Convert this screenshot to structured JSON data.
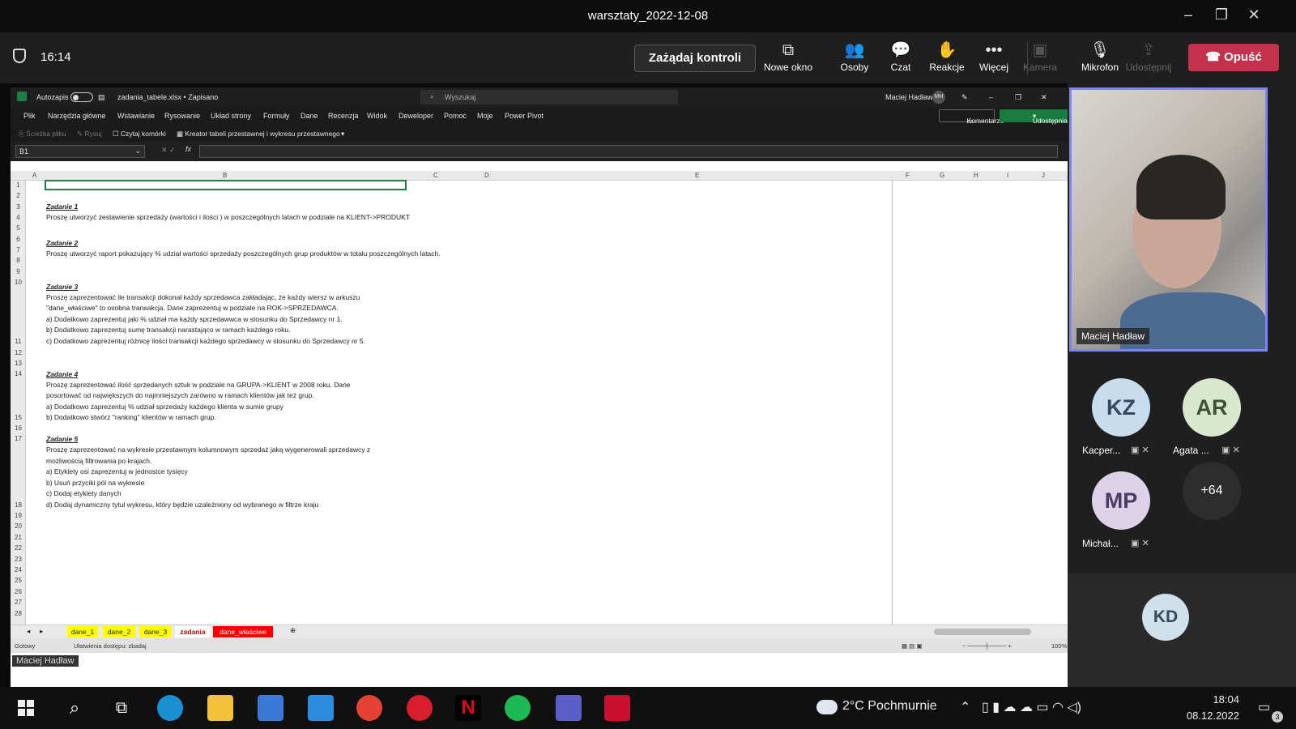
{
  "window": {
    "title": "warsztaty_2022-12-08"
  },
  "teams": {
    "timer": "16:14",
    "request_control": "Zażądaj kontroli",
    "toolbar": [
      {
        "label": "Nowe okno",
        "icon": "new-window-icon",
        "glyph": "⧉",
        "enabled": true
      },
      {
        "label": "Osoby",
        "icon": "people-icon",
        "glyph": "👥",
        "enabled": true
      },
      {
        "label": "Czat",
        "icon": "chat-icon",
        "glyph": "💬",
        "enabled": true
      },
      {
        "label": "Reakcje",
        "icon": "reactions-icon",
        "glyph": "✋",
        "enabled": true
      },
      {
        "label": "Więcej",
        "icon": "more-icon",
        "glyph": "•••",
        "enabled": true
      },
      {
        "label": "Kamera",
        "icon": "camera-off-icon",
        "glyph": "▣",
        "enabled": false
      },
      {
        "label": "Mikrofon",
        "icon": "mic-off-icon",
        "glyph": "🎙",
        "enabled": true
      },
      {
        "label": "Udostępnij",
        "icon": "share-icon",
        "glyph": "⇪",
        "enabled": false
      }
    ],
    "leave": "Opuść",
    "leave_color": "#c4314b"
  },
  "excel": {
    "autosave": "Autozapis",
    "filename": "zadania_tabele.xlsx • Zapisano",
    "search_placeholder": "Wyszukaj",
    "user": "Maciej Hadław",
    "user_initials": "MH",
    "menu": [
      "Plik",
      "Narzędzia główne",
      "Wstawianie",
      "Rysowanie",
      "Układ strony",
      "Formuły",
      "Dane",
      "Recenzja",
      "Widok",
      "Deweloper",
      "Pomoc",
      "Moje",
      "Power Pivot"
    ],
    "comments_btn": "Komentarze",
    "share_btn": "Udostępnianie",
    "quick": [
      "Ścieżka pliku",
      "Rysuj",
      "Czytaj komórki",
      "Kreator tabeli przestawnej i wykresu przestawnego"
    ],
    "namebox": "B1",
    "fx": "fx",
    "columns": [
      "A",
      "B",
      "C",
      "D",
      "E",
      "F",
      "G",
      "H",
      "I",
      "J"
    ],
    "rows": [
      "1",
      "2",
      "3",
      "4",
      "5",
      "6",
      "7",
      "8",
      "9",
      "10",
      "11",
      "12",
      "13",
      "14",
      "15",
      "16",
      "17",
      "18",
      "19",
      "20",
      "21",
      "22",
      "23",
      "24",
      "25",
      "26",
      "27",
      "28"
    ],
    "lines": [
      {
        "text": "Zadanie 1",
        "heading": true
      },
      {
        "text": "Proszę utworzyć zestawienie sprzedaży (wartości i ilości ) w poszczególnych latach w podziale na KLIENT->PRODUKT"
      },
      {
        "text": "Zadanie 2",
        "heading": true
      },
      {
        "text": "Proszę utworzyć raport pokazujący % udział wartości sprzedaży poszczególnych grup produktów w totalu poszczególnych latach."
      },
      {
        "text": "Zadanie 3",
        "heading": true
      },
      {
        "text": "Proszę zaprezentować ile transakcji dokonał każdy sprzedawca zakładając, że każdy wiersz w arkuszu"
      },
      {
        "text": "\"dane_właściwe\" to osobna transakcja. Dane zaprezentuj w podziale na ROK->SPRZEDAWCA."
      },
      {
        "text": "a) Dodatkowo zaprezentuj jaki % udział ma każdy sprzedawwca w stosunku do Sprzedawcy nr 1."
      },
      {
        "text": "b) Dodatkowo zaprezentuj sumę transakcji narastająco w ramach każdego roku."
      },
      {
        "text": "c) Dodatkowo zaprezentuj różnicę ilości transakcji każdego sprzedawcy w stosunku do Sprzedawcy nr 5."
      },
      {
        "text": "Zadanie 4",
        "heading": true
      },
      {
        "text": "Proszę zaprezentować ilość sprzedanych sztuk w podziale na GRUPA->KLIENT w 2008 roku. Dane"
      },
      {
        "text": "posortować od największych do najmniejszych zarówno w ramach klientów jak też grup."
      },
      {
        "text": "a) Dodatkowo zaprezentuj % udział sprzedaży każdego klienta w sumie grupy"
      },
      {
        "text": "b) Dodatkowo stwórz \"ranking\" klientów w ramach grup."
      },
      {
        "text": "Zadanie 5",
        "heading": true
      },
      {
        "text": "Proszę zaprezentować na wykresie przestawnym kolumnowym sprzedaż jaką wygenerowali sprzedawcy z"
      },
      {
        "text": "możliwością filtrowania po krajach."
      },
      {
        "text": "a) Etykiety osi zaprezentuj w jednostce tysięcy"
      },
      {
        "text": "b) Usuń przyciki pól na wykresie"
      },
      {
        "text": "c) Dodaj etykiety danych"
      },
      {
        "text": "d) Dodaj dynamiczny tytuł wykresu, który będzie uzależniony od wybranego w filtrze kraju"
      }
    ],
    "sheets": [
      {
        "name": "dane_1",
        "style": "y"
      },
      {
        "name": "dane_2",
        "style": "y"
      },
      {
        "name": "dane_3",
        "style": "y"
      },
      {
        "name": "zadania",
        "style": "a"
      },
      {
        "name": "dane_właściwe",
        "style": "r"
      }
    ],
    "status_ready": "Gotowy",
    "status_access": "Ułatwienia dostępu: zbadaj",
    "zoom": "100%",
    "presenter": "Maciej Hadław"
  },
  "participants": {
    "video_name": "Maciej Hadław",
    "people": [
      {
        "initials": "KZ",
        "name": "Kacper...",
        "bg": "#c7dced",
        "fg": "#34495e"
      },
      {
        "initials": "AR",
        "name": "Agata ...",
        "bg": "#d9e8cc",
        "fg": "#3d5230"
      },
      {
        "initials": "MP",
        "name": "Michał...",
        "bg": "#ddd2ea",
        "fg": "#4b3b63"
      }
    ],
    "more": "+64",
    "bottom": {
      "initials": "KD",
      "bg": "#cfe0ea",
      "fg": "#33485a"
    }
  },
  "taskbar": {
    "weather": "2°C  Pochmurnie",
    "time": "18:04",
    "date": "08.12.2022",
    "notif": "3"
  }
}
